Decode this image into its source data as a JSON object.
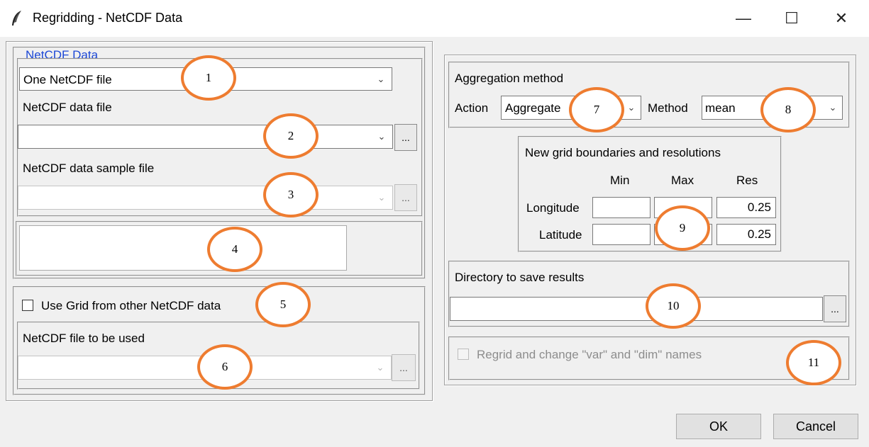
{
  "window": {
    "title": "Regridding - NetCDF Data",
    "icon": "feather-icon",
    "controls": {
      "minimize": "—",
      "maximize": "☐",
      "close": "✕"
    }
  },
  "netcdf_data": {
    "group_label": "NetCDF Data",
    "source_type": {
      "value": "One NetCDF file"
    },
    "data_file": {
      "label": "NetCDF data file",
      "value": ""
    },
    "sample_file": {
      "label": "NetCDF data sample file",
      "value": ""
    },
    "browse_label": "..."
  },
  "grid_other": {
    "checkbox_label": "Use Grid from other NetCDF data",
    "checked": false,
    "file": {
      "label": "NetCDF file to be used",
      "value": ""
    }
  },
  "aggregation": {
    "title": "Aggregation method",
    "action_label": "Action",
    "action_value": "Aggregate",
    "method_label": "Method",
    "method_value": "mean"
  },
  "grid": {
    "title": "New grid boundaries and resolutions",
    "headers": {
      "min": "Min",
      "max": "Max",
      "res": "Res"
    },
    "rows": [
      {
        "label": "Longitude",
        "min": "",
        "max": "",
        "res": "0.25"
      },
      {
        "label": "Latitude",
        "min": "",
        "max": "",
        "res": "0.25"
      }
    ]
  },
  "save": {
    "label": "Directory to save results",
    "value": "",
    "browse_label": "..."
  },
  "rename": {
    "checkbox_label": "Regrid and change \"var\" and \"dim\" names",
    "checked": false
  },
  "buttons": {
    "ok": "OK",
    "cancel": "Cancel"
  },
  "annotations": [
    "1",
    "2",
    "3",
    "4",
    "5",
    "6",
    "7",
    "8",
    "9",
    "10",
    "11"
  ],
  "colors": {
    "annotation_ring": "#ee7c30",
    "group_label": "#1c48d6"
  }
}
